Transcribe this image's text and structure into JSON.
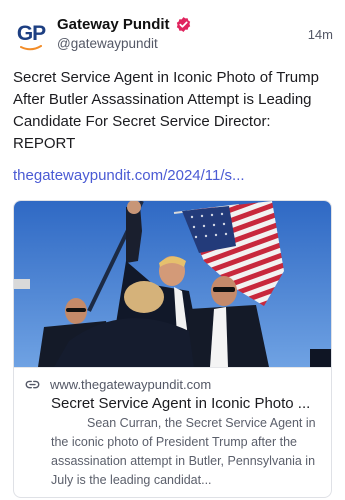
{
  "author": {
    "avatar_text": "GP",
    "name": "Gateway Pundit",
    "handle": "@gatewaypundit",
    "timestamp": "14m"
  },
  "post": {
    "text": "Secret Service Agent in Iconic Photo of Trump After Butler Assassination Attempt is Leading Candidate For Secret Service Director: REPORT",
    "link_text": "thegatewaypundit.com/2024/11/s..."
  },
  "card": {
    "domain": "www.thegatewaypundit.com",
    "title": "Secret Service Agent in Iconic Photo ...",
    "description": "Sean Curran, the Secret Service Agent in the iconic photo of President Trump after the assassination attempt in Butler, Pennsylvania in July is the leading candidat..."
  },
  "colors": {
    "accent_link": "#4b5bd4",
    "verified_badge": "#e0245e",
    "avatar_text": "#1d3f82",
    "avatar_swoosh": "#f28c28"
  },
  "icons": {
    "verified": "verified-badge-icon",
    "link": "link-icon"
  }
}
